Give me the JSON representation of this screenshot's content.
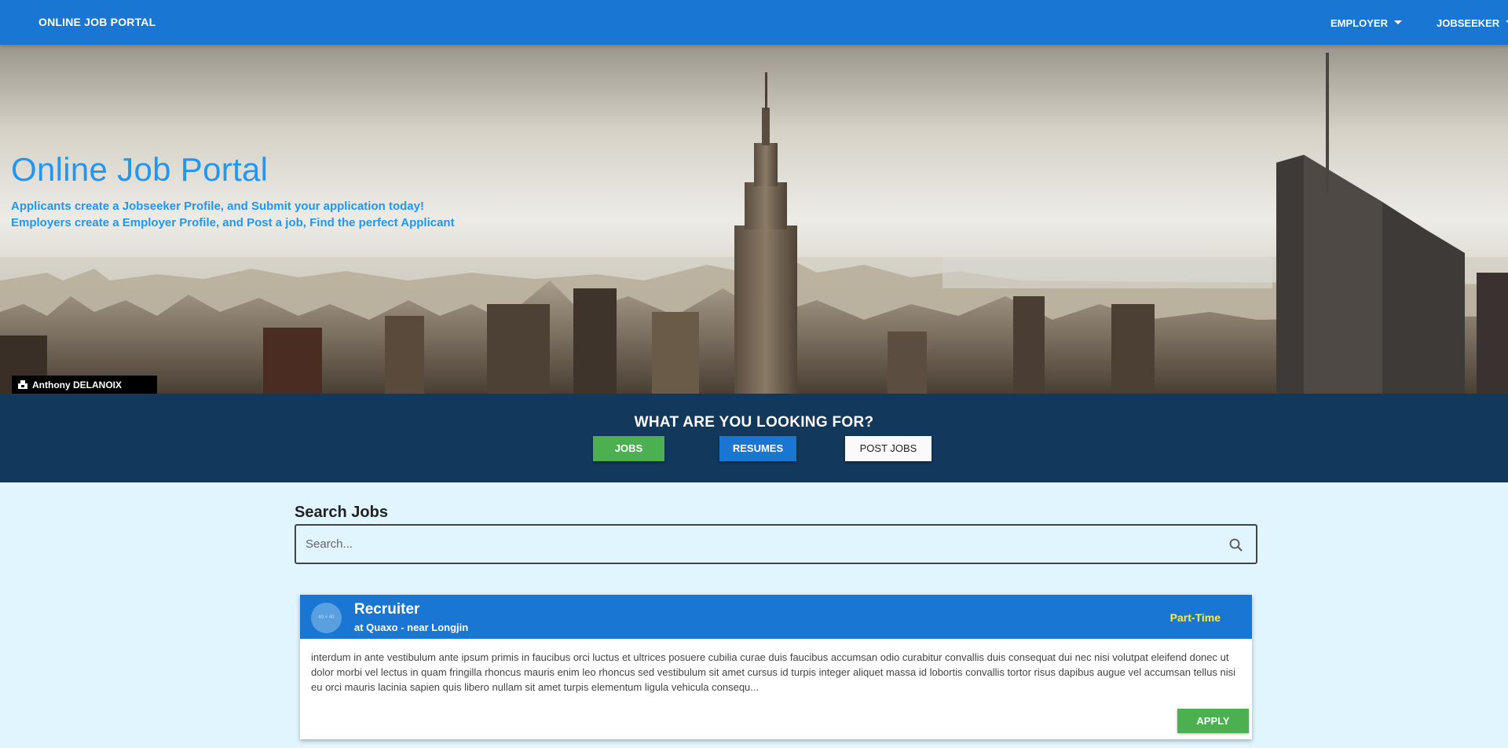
{
  "navbar": {
    "brand": "ONLINE JOB PORTAL",
    "menus": [
      {
        "label": "EMPLOYER"
      },
      {
        "label": "JOBSEEKER"
      }
    ]
  },
  "hero": {
    "title": "Online Job Portal",
    "line1": "Applicants create a Jobseeker Profile, and Submit your application today!",
    "line2": "Employers create a Employer Profile, and Post a job, Find the perfect Applicant",
    "photo_credit": "Anthony DELANOIX"
  },
  "looking": {
    "title": "WHAT ARE YOU LOOKING FOR?",
    "buttons": {
      "jobs": "JOBS",
      "resumes": "RESUMES",
      "post_jobs": "POST JOBS"
    }
  },
  "search": {
    "label": "Search Jobs",
    "placeholder": "Search..."
  },
  "job_card": {
    "avatar_text": "40 × 40",
    "title": "Recruiter",
    "subtitle": "at Quaxo - near Longjin",
    "type": "Part-Time",
    "description": "interdum in ante vestibulum ante ipsum primis in faucibus orci luctus et ultrices posuere cubilia curae duis faucibus accumsan odio curabitur convallis duis consequat dui nec nisi volutpat eleifend donec ut dolor morbi vel lectus in quam fringilla rhoncus mauris enim leo rhoncus sed vestibulum sit amet cursus id turpis integer aliquet massa id lobortis convallis tortor risus dapibus augue vel accumsan tellus nisi eu orci mauris lacinia sapien quis libero nullam sit amet turpis elementum ligula vehicula consequ...",
    "apply_label": "APPLY"
  },
  "colors": {
    "primary": "#1976d2",
    "success": "#4caf50",
    "dark_band": "#12385c",
    "page_bg": "#e1f5fe",
    "hero_text": "#2196f3",
    "job_type": "#ffeb3b"
  }
}
